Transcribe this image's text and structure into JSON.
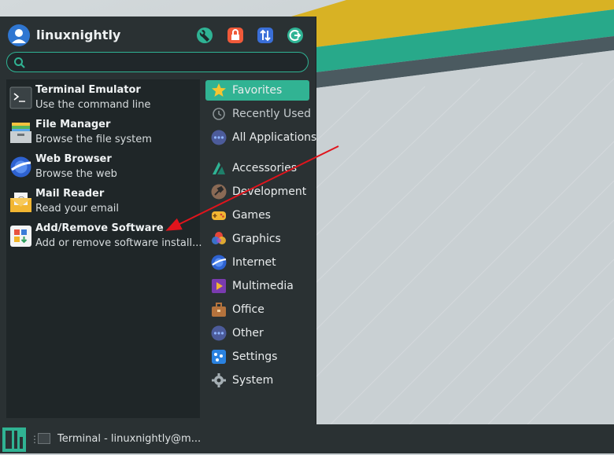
{
  "user": {
    "name": "linuxnightly"
  },
  "header_buttons": [
    "settings-manager-icon",
    "lock-screen-icon",
    "switch-user-icon",
    "log-out-icon"
  ],
  "search": {
    "placeholder": ""
  },
  "favorites": [
    {
      "title": "Terminal Emulator",
      "subtitle": "Use the command line",
      "icon": "terminal-icon"
    },
    {
      "title": "File Manager",
      "subtitle": "Browse the file system",
      "icon": "file-manager-icon"
    },
    {
      "title": "Web Browser",
      "subtitle": "Browse the web",
      "icon": "web-browser-icon"
    },
    {
      "title": "Mail Reader",
      "subtitle": "Read your email",
      "icon": "mail-icon"
    },
    {
      "title": "Add/Remove Software",
      "subtitle": "Add or remove software install...",
      "icon": "software-icon"
    }
  ],
  "categories": [
    {
      "label": "Favorites",
      "icon": "star-icon",
      "selected": true
    },
    {
      "label": "Recently Used",
      "icon": "clock-icon"
    },
    {
      "label": "All Applications",
      "icon": "all-apps-icon"
    },
    {
      "label": "Accessories",
      "icon": "accessories-icon"
    },
    {
      "label": "Development",
      "icon": "development-icon"
    },
    {
      "label": "Games",
      "icon": "games-icon"
    },
    {
      "label": "Graphics",
      "icon": "graphics-icon"
    },
    {
      "label": "Internet",
      "icon": "internet-icon"
    },
    {
      "label": "Multimedia",
      "icon": "multimedia-icon"
    },
    {
      "label": "Office",
      "icon": "office-icon"
    },
    {
      "label": "Other",
      "icon": "other-icon"
    },
    {
      "label": "Settings",
      "icon": "settings-icon"
    },
    {
      "label": "System",
      "icon": "system-icon"
    }
  ],
  "taskbar": {
    "task_label": "Terminal - linuxnightly@m..."
  },
  "colors": {
    "accent": "#31b393",
    "panel": "#2a3133",
    "arrow": "#e0141c"
  }
}
